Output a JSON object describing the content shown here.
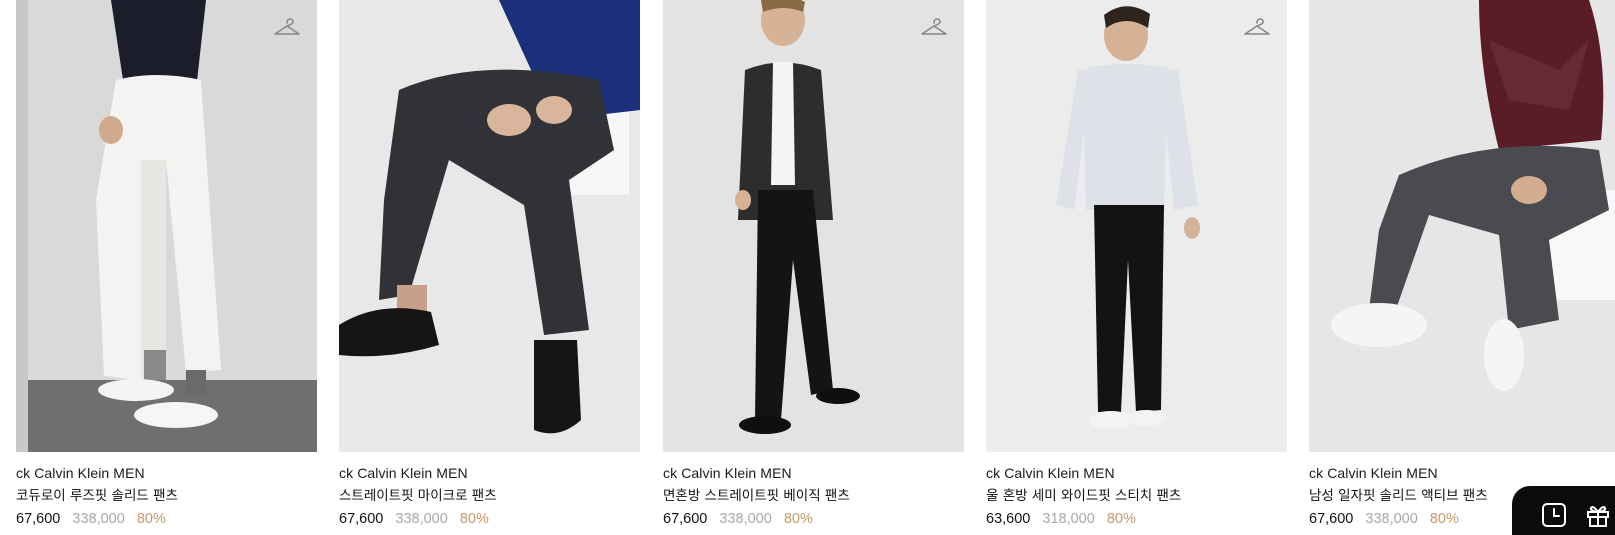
{
  "products": [
    {
      "brand": "ck Calvin Klein MEN",
      "name": "코듀로이 루즈핏 솔리드 팬츠",
      "price": "67,600",
      "original_price": "338,000",
      "discount": "80%",
      "icon": "hanger-icon"
    },
    {
      "brand": "ck Calvin Klein MEN",
      "name": "스트레이트핏 마이크로 팬츠",
      "price": "67,600",
      "original_price": "338,000",
      "discount": "80%",
      "icon": "hanger-icon"
    },
    {
      "brand": "ck Calvin Klein MEN",
      "name": "면혼방 스트레이트핏 베이직 팬츠",
      "price": "67,600",
      "original_price": "338,000",
      "discount": "80%",
      "icon": "hanger-icon"
    },
    {
      "brand": "ck Calvin Klein MEN",
      "name": "울 혼방 세미 와이드핏 스티치 팬츠",
      "price": "63,600",
      "original_price": "318,000",
      "discount": "80%",
      "icon": "hanger-icon"
    },
    {
      "brand": "ck Calvin Klein MEN",
      "name": "남성 일자핏 솔리드 액티브 팬츠",
      "price": "67,600",
      "original_price": "338,000",
      "discount": "80%",
      "icon": "hanger-icon"
    }
  ],
  "floating_bar": {
    "recent_icon": "clock-icon",
    "gift_icon": "gift-icon",
    "background": "#0b0b0b"
  },
  "colors": {
    "sale_price": "#111111",
    "original_price": "#a8a8a8",
    "discount": "#c59a6a"
  }
}
